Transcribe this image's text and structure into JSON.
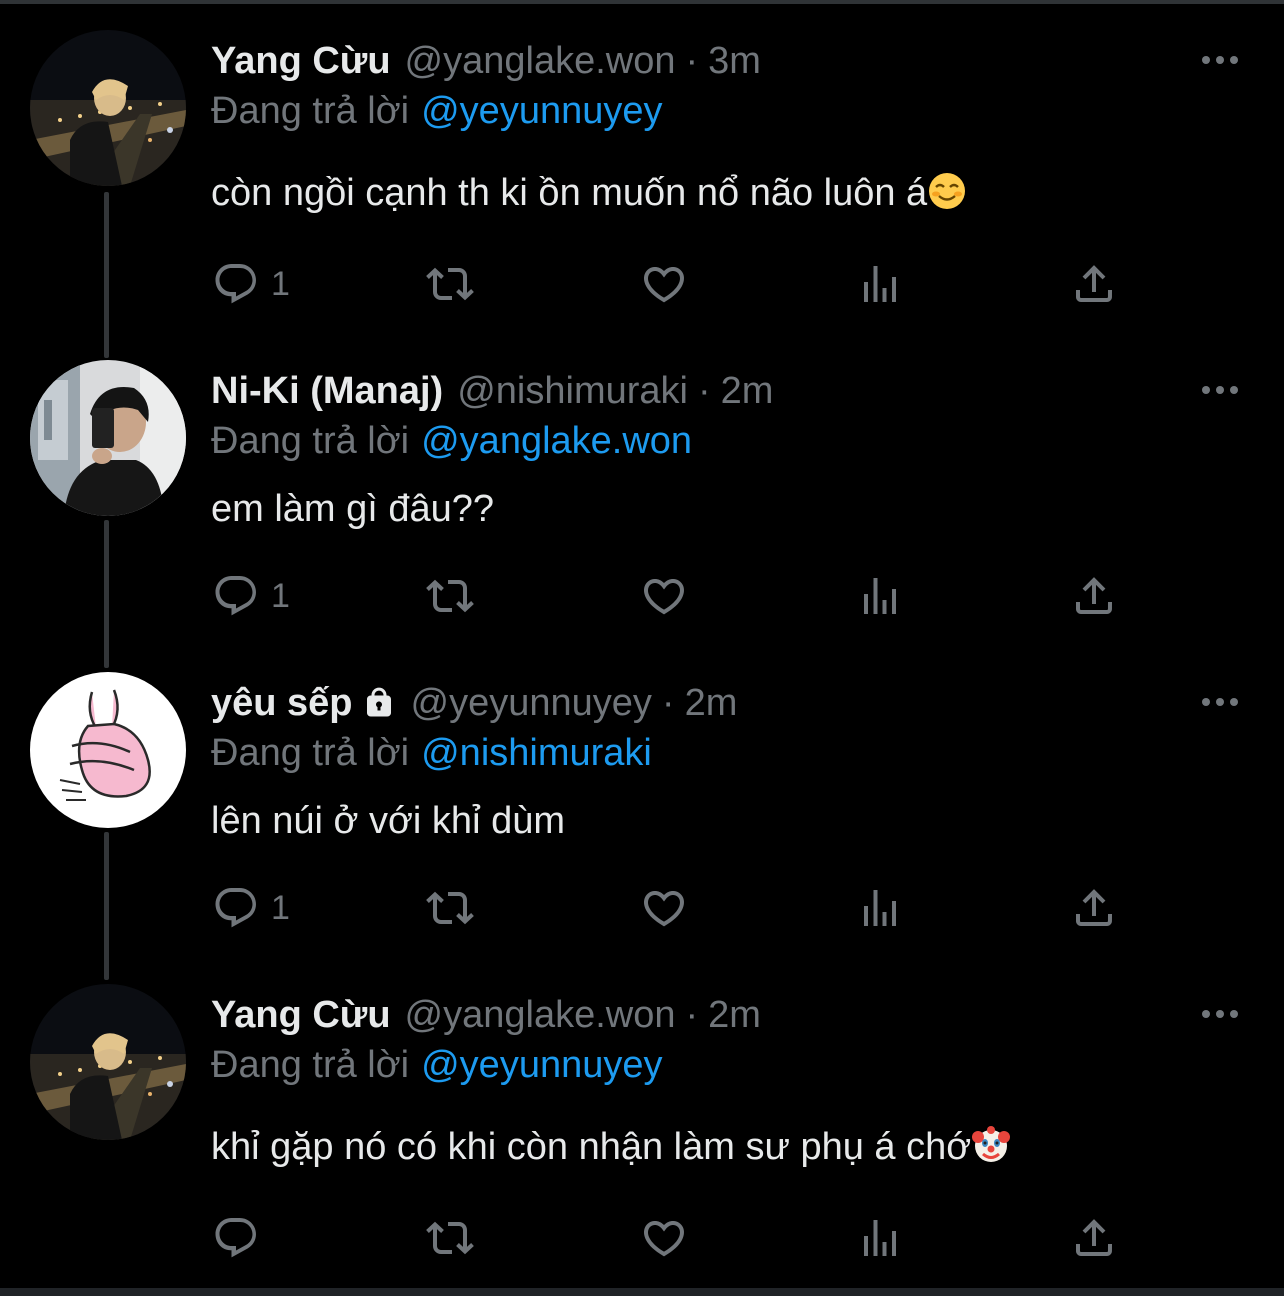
{
  "reply_prefix": "Đang trả lời",
  "tweets": [
    {
      "name": "Yang Cừu",
      "handle": "@yanglake.won",
      "separator": "·",
      "time": "3m",
      "reply_to": "@yeyunnuyey",
      "text": "còn ngồi cạnh th ki ồn muốn nổ não luôn á",
      "emoji": "smiling-face-emoji",
      "reply_count": "1",
      "avatar": "night-city-photo"
    },
    {
      "name": "Ni-Ki (Manaj)",
      "handle": "@nishimuraki",
      "separator": "·",
      "time": "2m",
      "reply_to": "@yanglake.won",
      "text": "em làm gì đâu??",
      "emoji": "",
      "reply_count": "1",
      "avatar": "mirror-selfie-photo"
    },
    {
      "name": "yêu sếp",
      "locked": true,
      "handle": "@yeyunnuyey",
      "separator": "·",
      "time": "2m",
      "reply_to": "@nishimuraki",
      "text": "lên núi ở với khỉ dùm",
      "emoji": "",
      "reply_count": "1",
      "avatar": "pink-rabbit-drawing"
    },
    {
      "name": "Yang Cừu",
      "handle": "@yanglake.won",
      "separator": "·",
      "time": "2m",
      "reply_to": "@yeyunnuyey",
      "text": "khỉ gặp nó có khi còn nhận làm sư phụ á chớ",
      "emoji": "clown-face-emoji",
      "reply_count": "",
      "avatar": "night-city-photo"
    }
  ],
  "colors": {
    "background": "#000000",
    "text": "#e7e9ea",
    "secondary": "#71767b",
    "link": "#1d9bf0",
    "thread_line": "#333639"
  },
  "icons": [
    "reply-icon",
    "retweet-icon",
    "like-icon",
    "views-icon",
    "share-icon",
    "more-icon",
    "lock-icon"
  ]
}
